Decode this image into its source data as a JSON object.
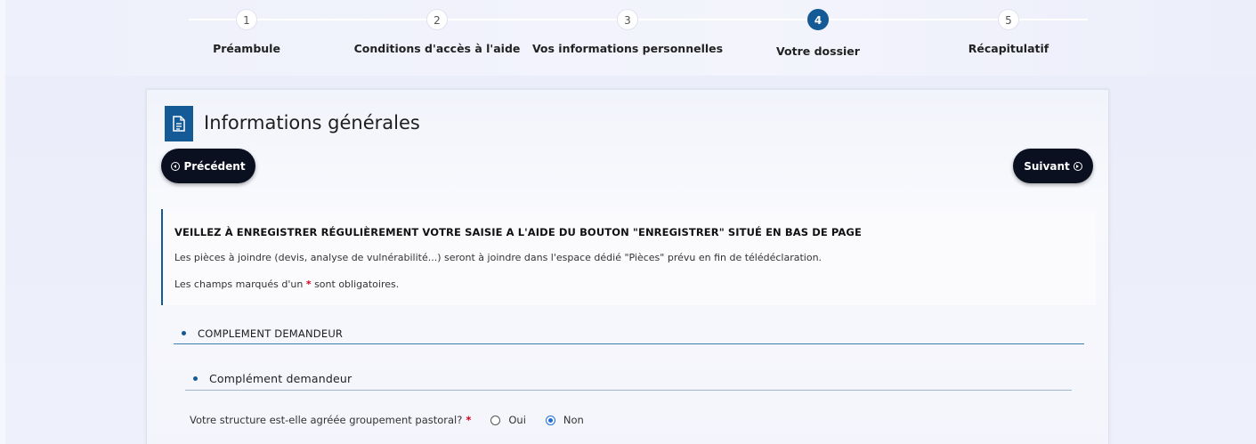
{
  "stepper": {
    "steps": [
      {
        "number": "1",
        "label": "Préambule",
        "active": false
      },
      {
        "number": "2",
        "label": "Conditions d'accès à l'aide",
        "active": false
      },
      {
        "number": "3",
        "label": "Vos informations personnelles",
        "active": false
      },
      {
        "number": "4",
        "label": "Votre dossier",
        "active": true
      },
      {
        "number": "5",
        "label": "Récapitulatif",
        "active": false
      }
    ]
  },
  "header": {
    "title": "Informations générales",
    "icon": "document-icon"
  },
  "navigation": {
    "previous_label": "Précédent",
    "next_label": "Suivant"
  },
  "notice": {
    "title": "VEILLEZ À ENREGISTRER RÉGULIÈREMENT VOTRE SAISIE A L'AIDE DU BOUTON \"ENREGISTRER\" SITUÉ EN BAS DE PAGE",
    "line1": "Les pièces à joindre (devis, analyse de vulnérabilité...) seront à joindre dans l'espace dédié \"Pièces\" prévu en fin de télédéclaration.",
    "line2_prefix": "Les champs marqués d'un",
    "line2_star": "*",
    "line2_suffix": "sont obligatoires."
  },
  "sections": {
    "section1_label": "COMPLEMENT DEMANDEUR",
    "section2_label": "Complément demandeur"
  },
  "question": {
    "label": "Votre structure est-elle agréée groupement pastoral?",
    "required_star": "*",
    "options": [
      {
        "label": "Oui",
        "selected": false
      },
      {
        "label": "Non",
        "selected": true
      }
    ]
  },
  "colors": {
    "accent": "#135a96",
    "button_bg": "#0b1020",
    "required": "#d0021b",
    "radio_selected": "#1f6fd8"
  }
}
